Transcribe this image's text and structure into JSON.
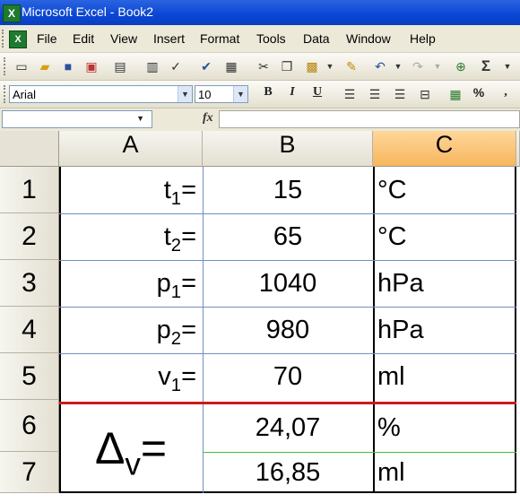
{
  "window": {
    "title": "Microsoft Excel - Book2",
    "app_icon": "excel-icon"
  },
  "menu": {
    "items": [
      "File",
      "Edit",
      "View",
      "Insert",
      "Format",
      "Tools",
      "Data",
      "Window",
      "Help"
    ]
  },
  "toolbar": {
    "buttons": [
      "new-icon",
      "open-icon",
      "save-icon",
      "permission-icon",
      "print-icon",
      "print-preview-icon",
      "spelling-icon",
      "research-icon",
      "cut-icon",
      "copy-icon",
      "paste-icon",
      "format-painter-icon",
      "undo-icon",
      "redo-icon",
      "hyperlink-icon",
      "autosum-icon"
    ],
    "font_name": "Arial",
    "font_size": "10",
    "bold": "B",
    "italic": "I",
    "underline": "U",
    "percent": "%"
  },
  "formula_bar": {
    "name_box": "",
    "fx_label": "fx",
    "content": ""
  },
  "sheet": {
    "columns": [
      "A",
      "B",
      "C"
    ],
    "active_column": "C",
    "rows": [
      "1",
      "2",
      "3",
      "4",
      "5",
      "6",
      "7"
    ],
    "labels": [
      {
        "base": "t",
        "sub": "1",
        "eq": "="
      },
      {
        "base": "t",
        "sub": "2",
        "eq": "="
      },
      {
        "base": "p",
        "sub": "1",
        "eq": "="
      },
      {
        "base": "p",
        "sub": "2",
        "eq": "="
      },
      {
        "base": "v",
        "sub": "1",
        "eq": "="
      }
    ],
    "values": [
      "15",
      "65",
      "1040",
      "980",
      "70",
      "24,07",
      "16,85"
    ],
    "units": [
      "°C",
      "°C",
      "hPa",
      "hPa",
      "ml",
      "%",
      "ml"
    ],
    "result_label": {
      "base": "Δ",
      "sub": "v",
      "eq": "="
    }
  },
  "colors": {
    "separator_red": "#cc1a1a",
    "separator_green": "#3fbf3f",
    "active_header": "#f7b65e"
  }
}
